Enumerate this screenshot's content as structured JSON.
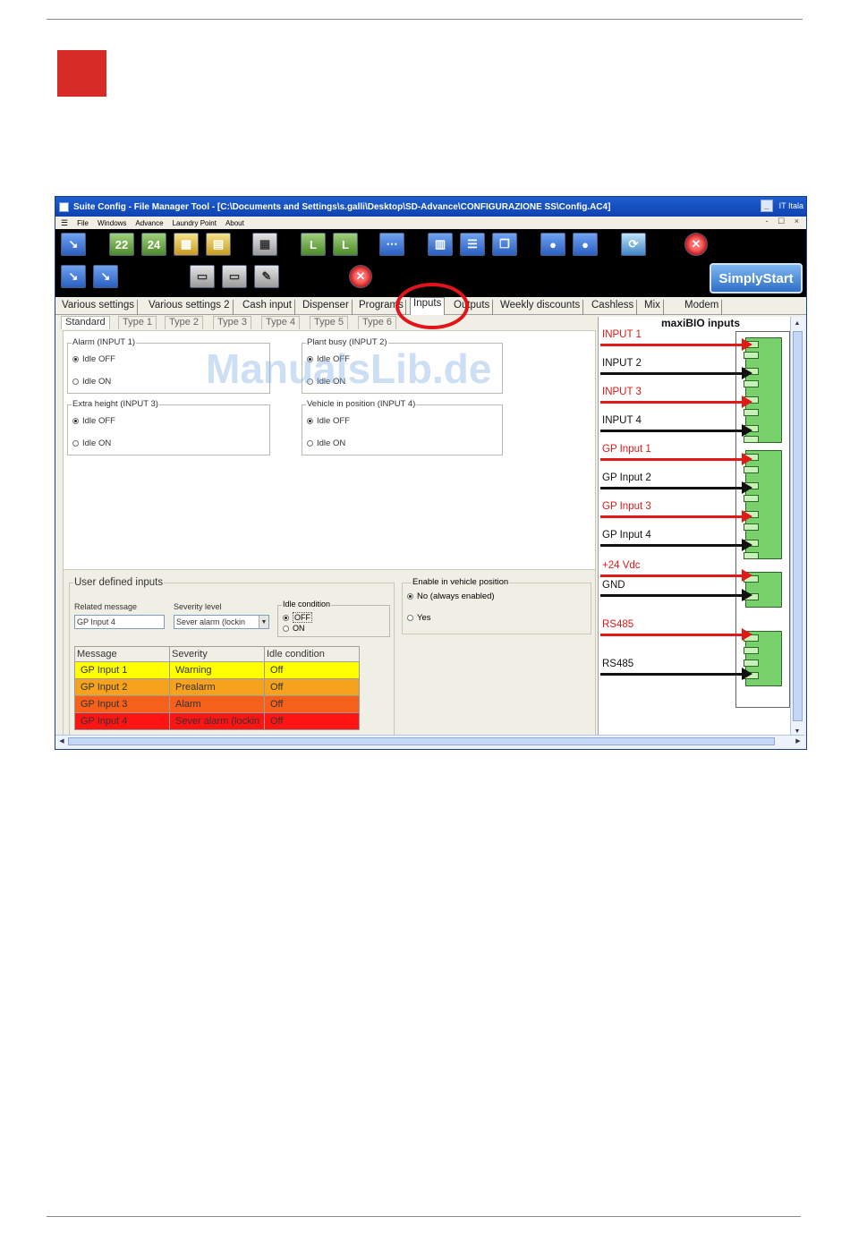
{
  "screenshot": {
    "title": "Suite Config - File Manager Tool - [C:\\Documents and Settings\\s.galli\\Desktop\\SD-Advance\\CONFIGURAZIONE SS\\Config.AC4]",
    "language": "IT Itala",
    "window_buttons": [
      "_",
      "□",
      "×"
    ],
    "menu": [
      "File",
      "Windows",
      "Advance",
      "Laundry Point",
      "About"
    ],
    "menu_right": "- ☐ ×",
    "simplystart_label": "SimplyStart",
    "tabs": [
      "Various settings",
      "Various settings 2",
      "Cash input",
      "Dispenser",
      "Programs",
      "Inputs",
      "Outputs",
      "Weekly discounts",
      "Cashless",
      "Mix",
      "Modem"
    ],
    "active_tab": "Inputs",
    "subtabs": [
      "Standard",
      "Type 1",
      "Type 2",
      "Type 3",
      "Type 4",
      "Type 5",
      "Type 6"
    ],
    "groups": {
      "alarm": {
        "title": "Alarm (INPUT 1)",
        "opt1": "Idle OFF",
        "opt2": "Idle ON",
        "selected": "Idle OFF"
      },
      "plant_busy": {
        "title": "Plant busy (INPUT 2)",
        "opt1": "Idle OFF",
        "opt2": "Idle ON",
        "selected": "Idle OFF"
      },
      "extra_height": {
        "title": "Extra height (INPUT 3)",
        "opt1": "Idle OFF",
        "opt2": "Idle ON",
        "selected": "Idle OFF"
      },
      "vehicle": {
        "title": "Vehicle in position (INPUT 4)",
        "opt1": "Idle OFF",
        "opt2": "Idle ON",
        "selected": "Idle OFF"
      }
    },
    "user_defined": {
      "title": "User defined inputs",
      "related_message_label": "Related message",
      "related_message_value": "GP Input 4",
      "severity_label": "Severity level",
      "severity_value": "Sever alarm (lockin",
      "idle_condition_label": "Idle condition",
      "idle_off": "OFF",
      "idle_on": "ON",
      "table_headers": [
        "Message",
        "Severity",
        "Idle condition"
      ],
      "rows": [
        {
          "message": "GP Input 1",
          "severity": "Warning",
          "idle": "Off",
          "color": "#ffff00"
        },
        {
          "message": "GP Input 2",
          "severity": "Prealarm",
          "idle": "Off",
          "color": "#f7a21c"
        },
        {
          "message": "GP Input 3",
          "severity": "Alarm",
          "idle": "Off",
          "color": "#f5601a"
        },
        {
          "message": "GP Input 4",
          "severity": "Sever alarm (lockin",
          "idle": "Off",
          "color": "#ff1414"
        }
      ]
    },
    "visibility": {
      "title": "Enable in vehicle position",
      "opt_no": "No (always enabled)",
      "opt_yes": "Yes"
    },
    "diagram": {
      "title": "maxiBIO inputs",
      "signals": [
        {
          "label": "INPUT 1",
          "color": "#e11818"
        },
        {
          "label": "INPUT 2",
          "color": "#111111"
        },
        {
          "label": "INPUT 3",
          "color": "#e11818"
        },
        {
          "label": "INPUT 4",
          "color": "#111111"
        },
        {
          "label": "GP Input 1",
          "color": "#e11818"
        },
        {
          "label": "GP Input 2",
          "color": "#111111"
        },
        {
          "label": "GP Input 3",
          "color": "#e11818"
        },
        {
          "label": "GP Input 4",
          "color": "#111111"
        },
        {
          "label": "+24 Vdc",
          "color": "#e11818"
        },
        {
          "label": "GND",
          "color": "#111111"
        },
        {
          "label": "RS485",
          "color": "#e11818"
        },
        {
          "label": "RS485",
          "color": "#111111"
        }
      ]
    }
  },
  "watermark": "ManualsLib.de",
  "colors": {
    "accent_red": "#d62b27",
    "highlight": "#e2141a"
  }
}
